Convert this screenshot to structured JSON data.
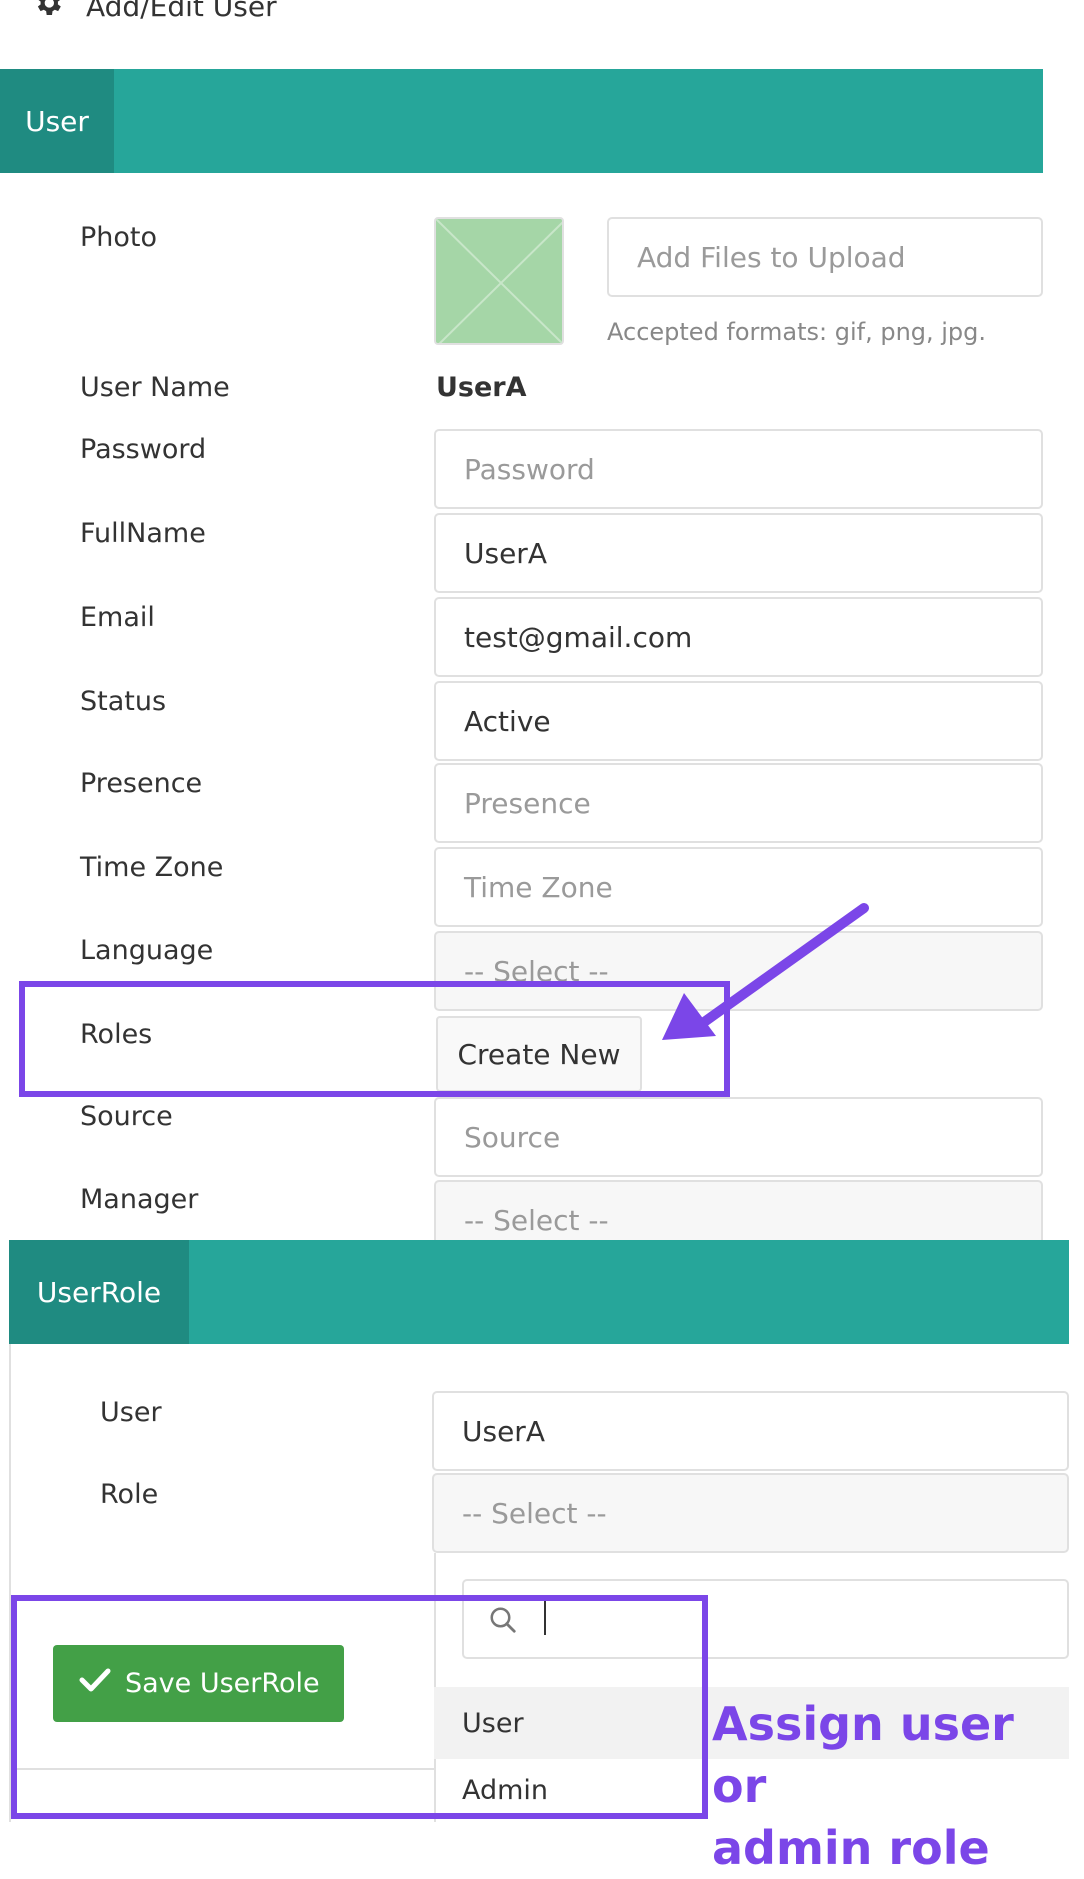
{
  "page": {
    "title": "Add/Edit User"
  },
  "user_section": {
    "tab_label": "User",
    "photo": {
      "label": "Photo",
      "upload_placeholder": "Add Files to Upload",
      "accepted_formats": "Accepted formats: gif, png, jpg."
    },
    "username": {
      "label": "User Name",
      "value": "UserA"
    },
    "password": {
      "label": "Password",
      "placeholder": "Password"
    },
    "fullname": {
      "label": "FullName",
      "value": "UserA"
    },
    "email": {
      "label": "Email",
      "value": "test@gmail.com"
    },
    "status": {
      "label": "Status",
      "value": "Active"
    },
    "presence": {
      "label": "Presence",
      "placeholder": "Presence"
    },
    "timezone": {
      "label": "Time Zone",
      "placeholder": "Time Zone"
    },
    "language": {
      "label": "Language",
      "placeholder": "-- Select --"
    },
    "roles": {
      "label": "Roles",
      "button": "Create New"
    },
    "source": {
      "label": "Source",
      "placeholder": "Source"
    },
    "manager": {
      "label": "Manager",
      "placeholder": "-- Select --"
    }
  },
  "userrole_section": {
    "tab_label": "UserRole",
    "user": {
      "label": "User",
      "value": "UserA"
    },
    "role": {
      "label": "Role",
      "placeholder": "-- Select --",
      "options": [
        "User",
        "Admin"
      ]
    },
    "save_button": "Save UserRole"
  },
  "annotation": {
    "line1": "Assign user or",
    "line2": "admin role",
    "color": "#7b46e8"
  },
  "colors": {
    "teal": "#26a69a",
    "teal_dark": "#1f8b81",
    "green": "#43a047"
  }
}
